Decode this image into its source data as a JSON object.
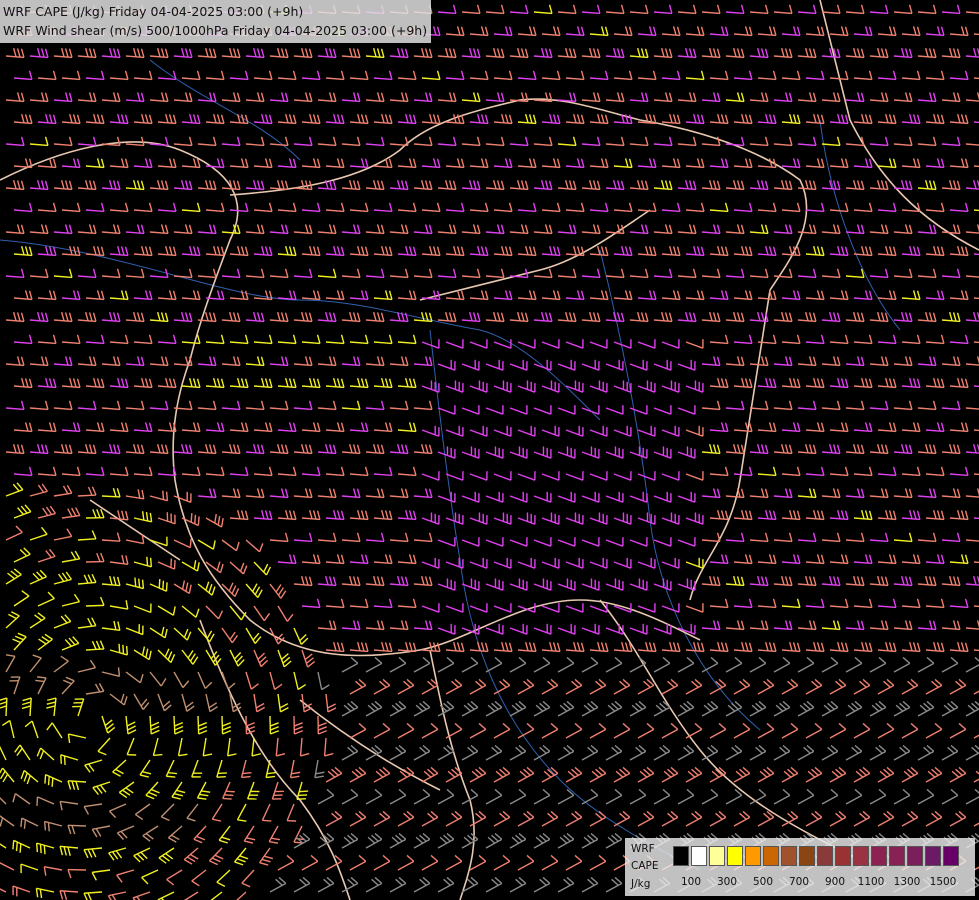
{
  "titles": {
    "line1": "WRF CAPE (J/kg) Friday 04-04-2025 03:00 (+9h)",
    "line2": "WRF Wind shear (m/s) 500/1000hPa Friday 04-04-2025 03:00 (+9h)"
  },
  "legend": {
    "model": "WRF",
    "field": "CAPE",
    "unit": "J/kg",
    "tick_labels": [
      "100",
      "300",
      "500",
      "700",
      "900",
      "1100",
      "1300",
      "1500"
    ],
    "swatch_colors": [
      "#000000",
      "#ffffff",
      "#ffff99",
      "#ffff00",
      "#ff9900",
      "#cc6600",
      "#a0522d",
      "#8b4513",
      "#8b3a3a",
      "#993333",
      "#993344",
      "#8b2252",
      "#882255",
      "#7a1f5c",
      "#6d1a66",
      "#660066"
    ]
  },
  "colors": {
    "background": "#000000",
    "barb_magenta": "#e040f0",
    "barb_salmon": "#f08070",
    "barb_yellow": "#f0f020",
    "barb_tan": "#c09070",
    "barb_gray": "#8a8a8a",
    "border": "#e8c8b0",
    "river": "#3060b0"
  }
}
